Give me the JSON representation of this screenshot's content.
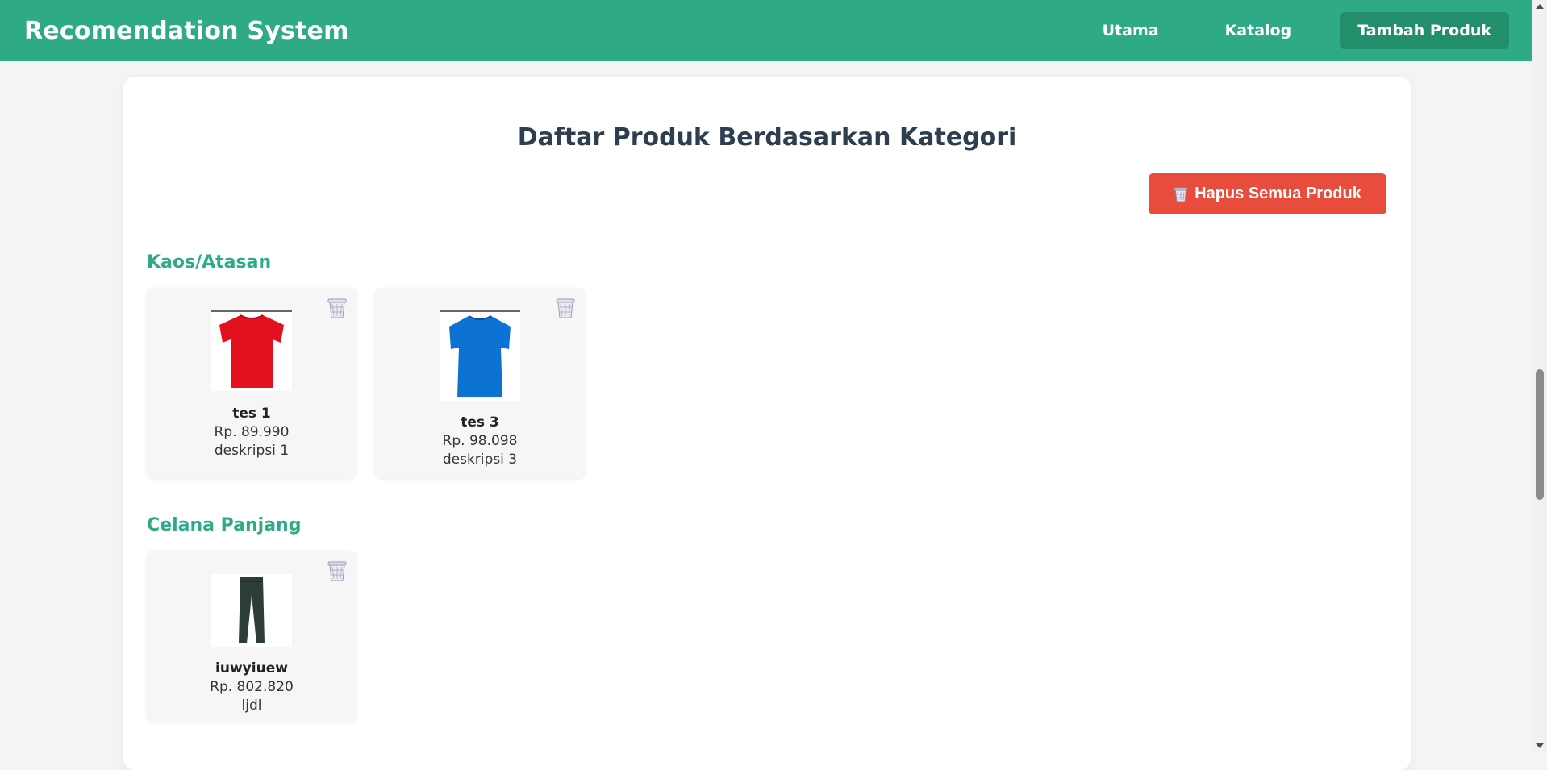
{
  "navbar": {
    "brand": "Recomendation System",
    "links": [
      {
        "label": "Utama"
      },
      {
        "label": "Katalog"
      },
      {
        "label": "Tambah Produk"
      }
    ]
  },
  "page": {
    "title": "Daftar Produk Berdasarkan Kategori",
    "delete_all_label": "Hapus Semua Produk"
  },
  "categories": [
    {
      "name": "Kaos/Atasan",
      "products": [
        {
          "name": "tes 1",
          "price": "Rp. 89.990",
          "description": "deskripsi 1",
          "image_icon": "red-tshirt-icon",
          "color": "#e3101d"
        },
        {
          "name": "tes 3",
          "price": "Rp. 98.098",
          "description": "deskripsi 3",
          "image_icon": "blue-tshirt-icon",
          "color": "#0c72d4"
        }
      ]
    },
    {
      "name": "Celana Panjang",
      "products": [
        {
          "name": "iuwyiuew",
          "price": "Rp. 802.820",
          "description": "ljdl",
          "image_icon": "pants-icon",
          "color": "#2c3d38"
        }
      ]
    }
  ],
  "colors": {
    "primary": "#2eaa86",
    "primary_dark": "#238e6b",
    "danger": "#e84c3d"
  }
}
